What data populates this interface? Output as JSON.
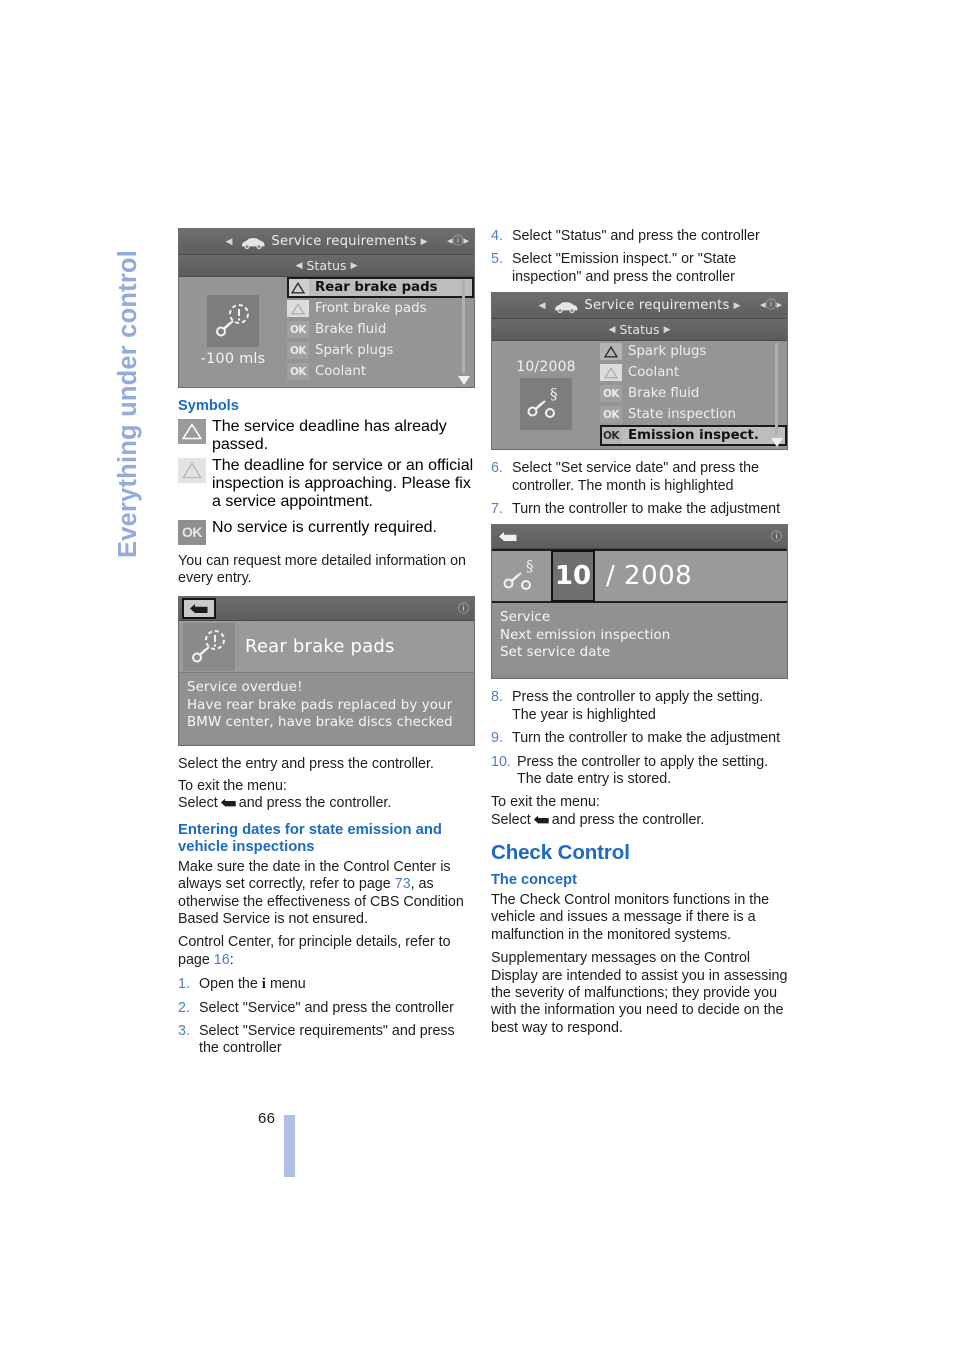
{
  "sidebar": {
    "title": "Everything under control"
  },
  "folio": {
    "page_number": "66"
  },
  "left": {
    "screenshot1": {
      "header_title": "Service requirements",
      "sub_title": "Status",
      "mileage": "-100 mls",
      "items": [
        {
          "icon": "warning-triangle",
          "label": "Rear brake pads",
          "selected": true
        },
        {
          "icon": "warning-triangle-light",
          "label": "Front brake pads",
          "selected": false
        },
        {
          "icon": "ok",
          "label": "Brake fluid",
          "selected": false
        },
        {
          "icon": "ok",
          "label": "Spark plugs",
          "selected": false
        },
        {
          "icon": "ok",
          "label": "Coolant",
          "selected": false
        }
      ]
    },
    "symbols_heading": "Symbols",
    "symbols": [
      {
        "icon": "warning-triangle",
        "text": "The service deadline has already passed."
      },
      {
        "icon": "warning-triangle-light",
        "text": "The deadline for service or an official inspection is approaching. Please fix a service appointment."
      },
      {
        "icon": "ok",
        "text": "No service is currently required."
      }
    ],
    "detail_note": "You can request more detailed information on every entry.",
    "screenshot2": {
      "title": "Rear brake pads",
      "line1": "Service overdue!",
      "line2": "Have rear brake pads replaced by your",
      "line3": "BMW center, have brake discs checked"
    },
    "select_entry": "Select the entry and press the controller.",
    "exit_label": "To exit the menu:",
    "exit_line_a": "Select",
    "exit_line_b": "and press the controller.",
    "entering_heading": "Entering dates for state emission and vehicle inspections",
    "para_make_sure_a": "Make sure the date in the Control Center is always set correctly, refer to page ",
    "para_make_sure_ref": "73",
    "para_make_sure_b": ", as otherwise the effectiveness of CBS Condition Based Service is not ensured.",
    "para_control_center_a": "Control Center, for principle details, refer to page ",
    "para_control_center_ref": "16",
    "para_control_center_b": ":",
    "steps": [
      {
        "num": "1.",
        "text_a": "Open the ",
        "glyph": "i",
        "text_b": " menu"
      },
      {
        "num": "2.",
        "text_a": "Select \"Service\" and press the controller",
        "glyph": "",
        "text_b": ""
      },
      {
        "num": "3.",
        "text_a": "Select \"Service requirements\" and press the controller",
        "glyph": "",
        "text_b": ""
      }
    ]
  },
  "right": {
    "steps_top": [
      {
        "num": "4.",
        "text": "Select \"Status\" and press the controller"
      },
      {
        "num": "5.",
        "text": "Select \"Emission inspect.\" or \"State inspection\" and press the controller"
      }
    ],
    "screenshot3": {
      "header_title": "Service requirements",
      "sub_title": "Status",
      "date": "10/2008",
      "items": [
        {
          "icon": "warning-triangle",
          "label": "Spark plugs",
          "selected": false
        },
        {
          "icon": "warning-triangle-light",
          "label": "Coolant",
          "selected": false
        },
        {
          "icon": "ok",
          "label": "Brake fluid",
          "selected": false
        },
        {
          "icon": "ok",
          "label": "State inspection",
          "selected": false
        },
        {
          "icon": "ok",
          "label": "Emission inspect.",
          "selected": true
        }
      ]
    },
    "steps_mid": [
      {
        "num": "6.",
        "text": "Select \"Set service date\" and press the controller. The month is highlighted"
      },
      {
        "num": "7.",
        "text": "Turn the controller to make the adjustment"
      }
    ],
    "screenshot4": {
      "month": "10",
      "year": "/ 2008",
      "line1": "Service",
      "line2": "Next emission inspection",
      "line3": "Set service date"
    },
    "steps_bottom": [
      {
        "num": "8.",
        "text": "Press the controller to apply the setting. The year is highlighted"
      },
      {
        "num": "9.",
        "text": "Turn the controller to make the adjustment"
      },
      {
        "num": "10.",
        "text": "Press the controller to apply the setting. The date entry is stored."
      }
    ],
    "exit_label": "To exit the menu:",
    "exit_line_a": "Select",
    "exit_line_b": "and press the controller.",
    "check_control_heading": "Check Control",
    "concept_heading": "The concept",
    "concept_p1": "The Check Control monitors functions in the vehicle and issues a message if there is a malfunction in the monitored systems.",
    "concept_p2": "Supplementary messages on the Control Display are intended to assist you in assessing the severity of malfunctions; they provide you with the information you need to decide on the best way to respond."
  },
  "colors": {
    "heading_blue": "#1b6ac4",
    "xref_blue": "#4f7fc8",
    "sidebar_blue": "#93aade",
    "folio_bar": "#aebfe4"
  }
}
